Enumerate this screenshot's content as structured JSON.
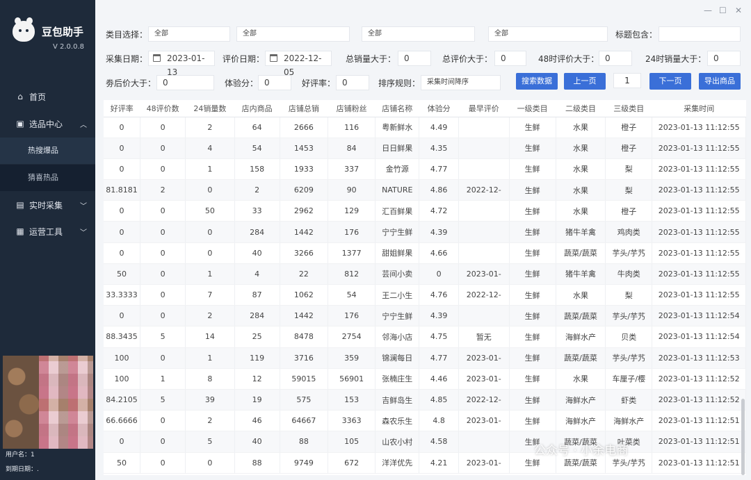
{
  "app": {
    "name": "豆包助手",
    "version": "V 2.0.0.8"
  },
  "sidebar": {
    "items": [
      {
        "label": "首页",
        "icon": "home-icon"
      },
      {
        "label": "选品中心",
        "icon": "product-icon",
        "expanded": true,
        "children": [
          {
            "label": "热搜爆品",
            "active": true
          },
          {
            "label": "猜喜热品",
            "active": false
          }
        ]
      },
      {
        "label": "实时采集",
        "icon": "collect-icon"
      },
      {
        "label": "运营工具",
        "icon": "tools-icon"
      }
    ],
    "user_label": "用户名：1",
    "expiry_label": "到期日期：."
  },
  "filters": {
    "category_label": "类目选择：",
    "category_values": [
      "全部",
      "全部",
      "全部",
      "全部"
    ],
    "title_contains_label": "标题包含：",
    "title_contains_value": "",
    "collect_date_label": "采集日期：",
    "collect_date_value": "2023-01-13",
    "review_date_label": "评价日期：",
    "review_date_value": "2022-12-05",
    "total_sales_label": "总销量大于：",
    "total_sales_value": "0",
    "total_reviews_label": "总评价大于：",
    "total_reviews_value": "0",
    "reviews48_label": "48时评价大于：",
    "reviews48_value": "0",
    "sales24_label": "24时销量大于：",
    "sales24_value": "0",
    "coupon_price_label": "劵后价大于：",
    "coupon_price_value": "0",
    "experience_label": "体验分：",
    "experience_value": "0",
    "good_rate_label": "好评率：",
    "good_rate_value": "0",
    "sort_label": "排序规则：",
    "sort_value": "采集时间降序"
  },
  "toolbar": {
    "search_label": "搜索数据",
    "prev_label": "上一页",
    "page_value": "1",
    "next_label": "下一页",
    "export_label": "导出商品"
  },
  "window": {
    "minimize": "—",
    "maximize": "☐",
    "close": "✕"
  },
  "table": {
    "columns": [
      "好评率",
      "48评价数",
      "24销量数",
      "店内商品",
      "店铺总销",
      "店铺粉丝",
      "店铺名称",
      "体验分",
      "最早评价",
      "一级类目",
      "二级类目",
      "三级类目",
      "采集时间"
    ],
    "rows": [
      [
        "0",
        "0",
        "2",
        "64",
        "2666",
        "116",
        "粤新鲜水",
        "4.49",
        "",
        "生鲜",
        "水果",
        "橙子",
        "2023-01-13 11:12:55"
      ],
      [
        "0",
        "0",
        "4",
        "54",
        "1453",
        "84",
        "日日鲜果",
        "4.35",
        "",
        "生鲜",
        "水果",
        "橙子",
        "2023-01-13 11:12:55"
      ],
      [
        "0",
        "0",
        "1",
        "158",
        "1933",
        "337",
        "金竹源",
        "4.77",
        "",
        "生鲜",
        "水果",
        "梨",
        "2023-01-13 11:12:55"
      ],
      [
        "81.8181",
        "2",
        "0",
        "2",
        "6209",
        "90",
        "NATURE",
        "4.86",
        "2022-12-",
        "生鲜",
        "水果",
        "梨",
        "2023-01-13 11:12:55"
      ],
      [
        "0",
        "0",
        "50",
        "33",
        "2962",
        "129",
        "汇百鲜果",
        "4.72",
        "",
        "生鲜",
        "水果",
        "橙子",
        "2023-01-13 11:12:55"
      ],
      [
        "0",
        "0",
        "0",
        "284",
        "1442",
        "176",
        "宁宁生鲜",
        "4.39",
        "",
        "生鲜",
        "猪牛羊禽",
        "鸡肉类",
        "2023-01-13 11:12:55"
      ],
      [
        "0",
        "0",
        "0",
        "40",
        "3266",
        "1377",
        "甜姐鲜果",
        "4.66",
        "",
        "生鲜",
        "蔬菜/蔬菜",
        "芋头/芋艿",
        "2023-01-13 11:12:55"
      ],
      [
        "50",
        "0",
        "1",
        "4",
        "22",
        "812",
        "芸间小卖",
        "0",
        "2023-01-",
        "生鲜",
        "猪牛羊禽",
        "牛肉类",
        "2023-01-13 11:12:55"
      ],
      [
        "33.3333",
        "0",
        "7",
        "87",
        "1062",
        "54",
        "王二小生",
        "4.76",
        "2022-12-",
        "生鲜",
        "水果",
        "梨",
        "2023-01-13 11:12:55"
      ],
      [
        "0",
        "0",
        "2",
        "284",
        "1442",
        "176",
        "宁宁生鲜",
        "4.39",
        "",
        "生鲜",
        "蔬菜/蔬菜",
        "芋头/芋艿",
        "2023-01-13 11:12:54"
      ],
      [
        "88.3435",
        "5",
        "14",
        "25",
        "8478",
        "2754",
        "邻海小店",
        "4.75",
        "暂无",
        "生鲜",
        "海鲜水产",
        "贝类",
        "2023-01-13 11:12:54"
      ],
      [
        "100",
        "0",
        "1",
        "119",
        "3716",
        "359",
        "锦澜每日",
        "4.77",
        "2023-01-",
        "生鲜",
        "蔬菜/蔬菜",
        "芋头/芋艿",
        "2023-01-13 11:12:53"
      ],
      [
        "100",
        "1",
        "8",
        "12",
        "59015",
        "56901",
        "张楠庄生",
        "4.46",
        "2023-01-",
        "生鲜",
        "水果",
        "车厘子/樱",
        "2023-01-13 11:12:52"
      ],
      [
        "84.2105",
        "5",
        "39",
        "19",
        "575",
        "153",
        "吉鲜岛生",
        "4.85",
        "2022-12-",
        "生鲜",
        "海鲜水产",
        "虾类",
        "2023-01-13 11:12:52"
      ],
      [
        "66.6666",
        "0",
        "2",
        "46",
        "64667",
        "3363",
        "森农乐生",
        "4.8",
        "2023-01-",
        "生鲜",
        "海鲜水产",
        "海鲜水产",
        "2023-01-13 11:12:51"
      ],
      [
        "0",
        "0",
        "5",
        "40",
        "88",
        "105",
        "山农小村",
        "4.58",
        "",
        "生鲜",
        "蔬菜/蔬菜",
        "叶菜类",
        "2023-01-13 11:12:51"
      ],
      [
        "50",
        "0",
        "0",
        "88",
        "9749",
        "672",
        "洋洋优先",
        "4.21",
        "2023-01-",
        "生鲜",
        "蔬菜/蔬菜",
        "芋头/芋艿",
        "2023-01-13 11:12:51"
      ]
    ]
  },
  "watermark": "公众号 · 小余电商",
  "colors": {
    "sidebar_bg": "#1e2a3a",
    "accent": "#3a6fd8",
    "main_bg": "#f3f5f8"
  }
}
